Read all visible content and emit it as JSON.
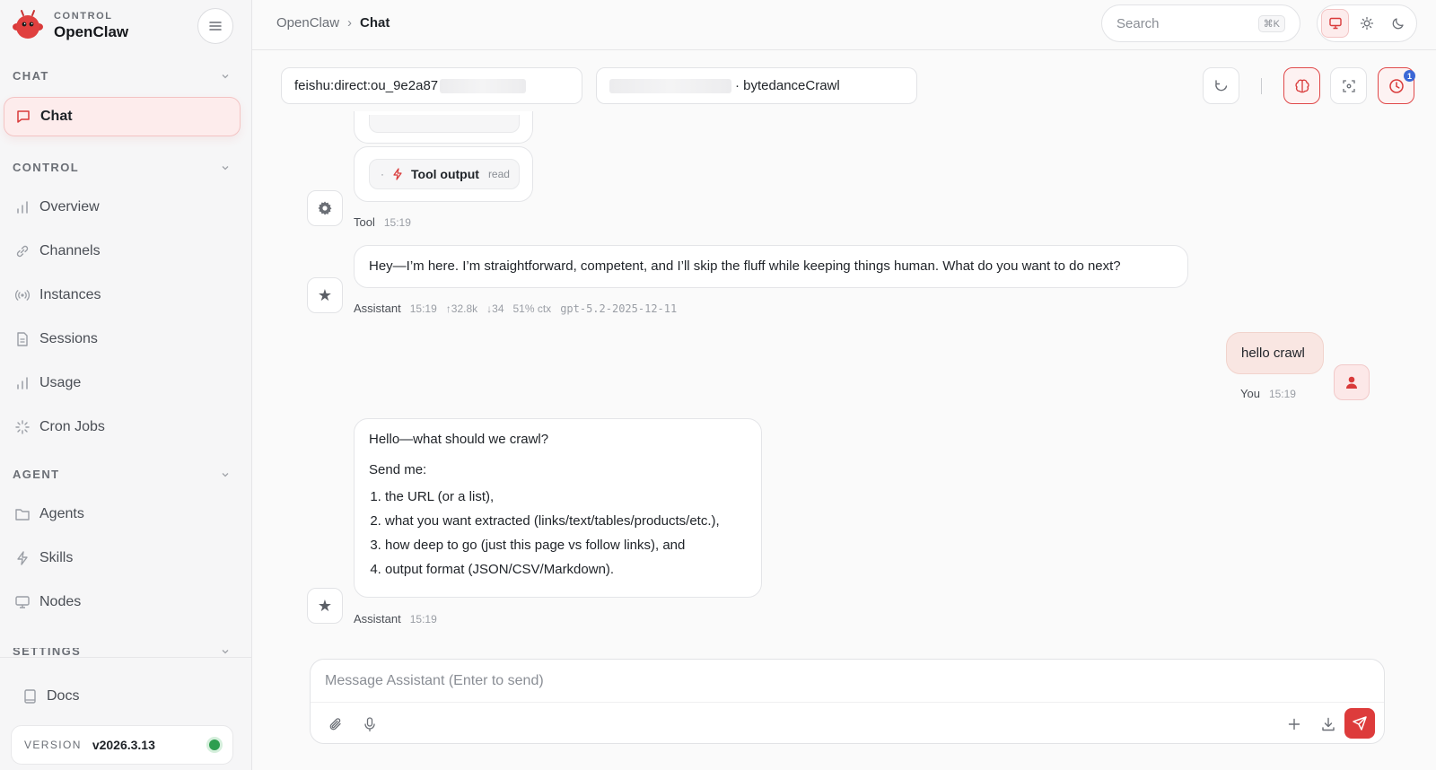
{
  "brand": {
    "subtitle": "CONTROL",
    "name": "OpenClaw"
  },
  "sidebar": {
    "sections": {
      "chat": "CHAT",
      "control": "CONTROL",
      "agent": "AGENT",
      "settings": "SETTINGS"
    },
    "items": {
      "chat": "Chat",
      "overview": "Overview",
      "channels": "Channels",
      "instances": "Instances",
      "sessions": "Sessions",
      "usage": "Usage",
      "cron": "Cron Jobs",
      "agents": "Agents",
      "skills": "Skills",
      "nodes": "Nodes",
      "docs": "Docs"
    },
    "version": {
      "label": "VERSION",
      "value": "v2026.3.13"
    }
  },
  "topbar": {
    "breadcrumb": {
      "root": "OpenClaw",
      "sep": "›",
      "current": "Chat"
    },
    "search": {
      "placeholder": "Search",
      "shortcut": "⌘K"
    }
  },
  "toolbar": {
    "session_prefix": "feishu:direct:ou_9e2a87",
    "agent_suffix": "· bytedanceCrawl",
    "notifications_count": "1"
  },
  "messages": {
    "tool": {
      "pill_label": "Tool output",
      "pill_tag": "read",
      "sender": "Tool",
      "time": "15:19"
    },
    "assistant1": {
      "text": "Hey—I’m here. I’m straightforward, competent, and I’ll skip the fluff while keeping things human. What do you want to do next?",
      "sender": "Assistant",
      "time": "15:19",
      "tokens_up": "↑32.8k",
      "tokens_down": "↓34",
      "ctx": "51% ctx",
      "model": "gpt-5.2-2025-12-11"
    },
    "user1": {
      "text": "hello crawl",
      "sender": "You",
      "time": "15:19"
    },
    "assistant2": {
      "line1": "Hello—what should we crawl?",
      "line2": "Send me:",
      "steps": [
        "the URL (or a list),",
        "what you want extracted (links/text/tables/products/etc.),",
        "how deep to go (just this page vs follow links), and",
        "output format (JSON/CSV/Markdown)."
      ],
      "sender": "Assistant",
      "time": "15:19"
    }
  },
  "composer": {
    "placeholder": "Message Assistant (Enter to send)"
  },
  "colors": {
    "accent": "#dd3b3b",
    "active_bg": "#fdecec",
    "status_ok": "#2e9e4f"
  }
}
